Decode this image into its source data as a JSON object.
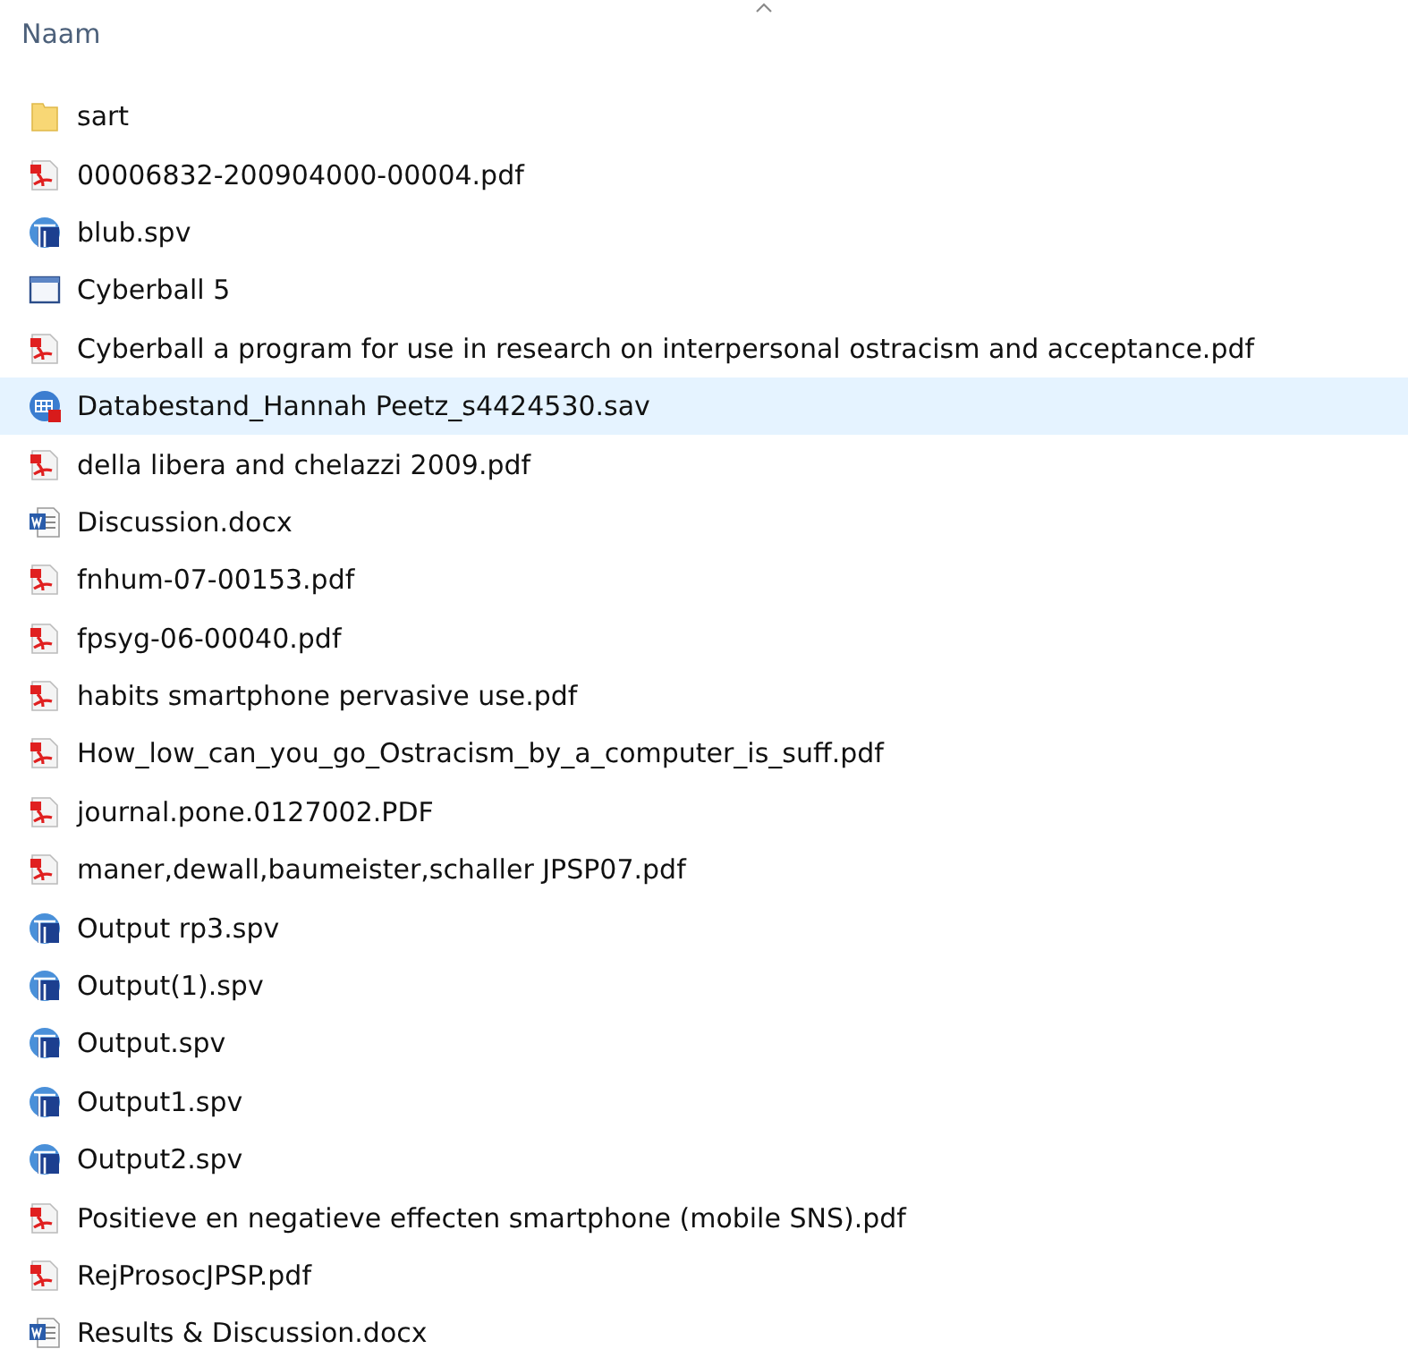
{
  "header": {
    "column": "Naam"
  },
  "files": [
    {
      "name": "sart",
      "kind": "folder",
      "selected": false
    },
    {
      "name": "00006832-200904000-00004.pdf",
      "kind": "pdf",
      "selected": false
    },
    {
      "name": "blub.spv",
      "kind": "spv",
      "selected": false
    },
    {
      "name": "Cyberball 5",
      "kind": "app",
      "selected": false
    },
    {
      "name": "Cyberball a program for use in research on interpersonal ostracism and acceptance.pdf",
      "kind": "pdf",
      "selected": false
    },
    {
      "name": "Databestand_Hannah Peetz_s4424530.sav",
      "kind": "sav",
      "selected": true
    },
    {
      "name": "della libera and chelazzi 2009.pdf",
      "kind": "pdf",
      "selected": false
    },
    {
      "name": "Discussion.docx",
      "kind": "docx",
      "selected": false
    },
    {
      "name": "fnhum-07-00153.pdf",
      "kind": "pdf",
      "selected": false
    },
    {
      "name": "fpsyg-06-00040.pdf",
      "kind": "pdf",
      "selected": false
    },
    {
      "name": "habits smartphone pervasive use.pdf",
      "kind": "pdf",
      "selected": false
    },
    {
      "name": "How_low_can_you_go_Ostracism_by_a_computer_is_suff.pdf",
      "kind": "pdf",
      "selected": false
    },
    {
      "name": "journal.pone.0127002.PDF",
      "kind": "pdf",
      "selected": false
    },
    {
      "name": "maner,dewall,baumeister,schaller JPSP07.pdf",
      "kind": "pdf",
      "selected": false
    },
    {
      "name": "Output rp3.spv",
      "kind": "spv",
      "selected": false
    },
    {
      "name": "Output(1).spv",
      "kind": "spv",
      "selected": false
    },
    {
      "name": "Output.spv",
      "kind": "spv",
      "selected": false
    },
    {
      "name": "Output1.spv",
      "kind": "spv",
      "selected": false
    },
    {
      "name": "Output2.spv",
      "kind": "spv",
      "selected": false
    },
    {
      "name": "Positieve en negatieve effecten smartphone (mobile SNS).pdf",
      "kind": "pdf",
      "selected": false
    },
    {
      "name": "RejProsocJPSP.pdf",
      "kind": "pdf",
      "selected": false
    },
    {
      "name": "Results & Discussion.docx",
      "kind": "docx",
      "selected": false
    }
  ]
}
